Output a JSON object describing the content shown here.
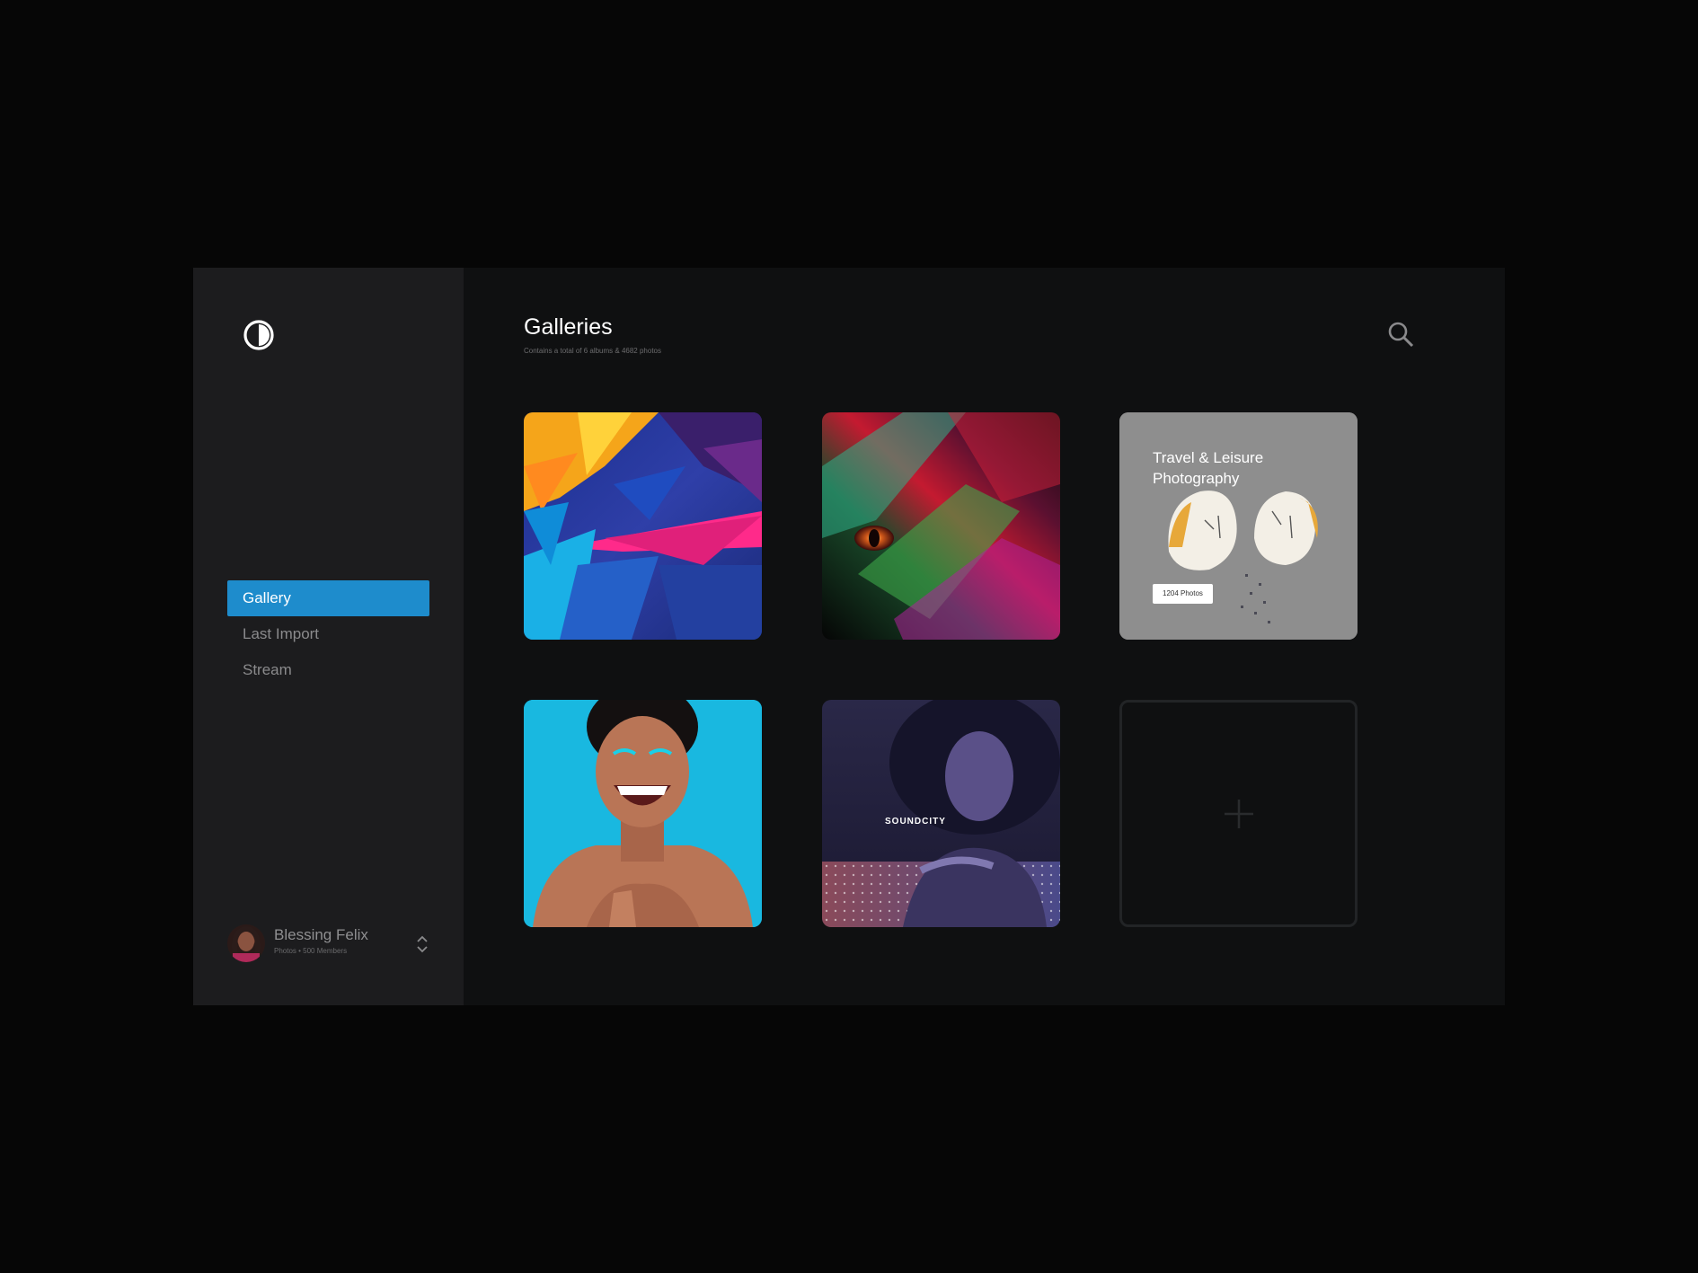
{
  "logo": {
    "icon": "half-circle-logo-icon"
  },
  "sidebar": {
    "items": [
      {
        "label": "Gallery",
        "active": true
      },
      {
        "label": "Last Import",
        "active": false
      },
      {
        "label": "Stream",
        "active": false
      }
    ]
  },
  "user": {
    "name": "Blessing Felix",
    "subtitle": "Photos • 500 Members",
    "menu_icon": "chevron-up-down-icon"
  },
  "header": {
    "title": "Galleries",
    "subtitle": "Contains a total of 6 albums & 4682 photos",
    "search_icon": "search-icon"
  },
  "albums": [
    {
      "image": "abstract-polygon-art"
    },
    {
      "image": "rainbow-reptile-eye-macro"
    },
    {
      "image": "cracked-eggshell",
      "title": "Travel & Leisure Photography",
      "badge": "1204 Photos"
    },
    {
      "image": "laughing-woman-blue-background"
    },
    {
      "image": "woman-portrait-purple",
      "label": "SOUNDCITY"
    },
    {
      "image": "add-album-placeholder",
      "icon": "plus-icon"
    }
  ],
  "colors": {
    "accent": "#1e8ccc",
    "sidebar_bg": "#1c1c1e",
    "main_bg": "#0f1011",
    "page_bg": "#060606"
  }
}
